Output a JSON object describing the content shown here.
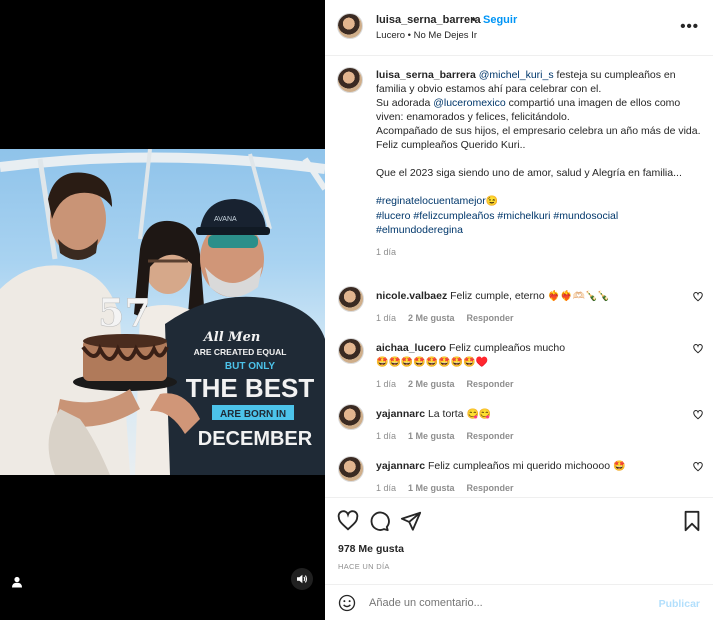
{
  "header": {
    "username": "luisa_serna_barrera",
    "dot": "•",
    "follow_label": "Seguir",
    "subtitle": "Lucero • No Me Dejes Ir",
    "more": "•••"
  },
  "photo": {
    "cake_number": "57",
    "shirt_lines": [
      "All Men",
      "ARE CREATED EQUAL",
      "BUT ONLY",
      "THE BEST",
      "ARE BORN IN",
      "DECEMBER"
    ],
    "cap_text": "AVANA"
  },
  "caption": {
    "username": "luisa_serna_barrera",
    "mention1": "@michel_kuri_s",
    "text1": " festeja su cumpleaños en familia y obvio estamos ahí para celebrar con el.",
    "text2a": "Su adorada ",
    "mention2": "@luceromexico",
    "text2b": " compartió una imagen de ellos como viven: enamorados y felices, felicitándolo.",
    "text3": "Acompañado de sus hijos, el empresario celebra un año más de vida.",
    "text4": "Feliz cumpleaños Querido Kuri..",
    "text5": "Que el 2023 siga siendo uno de amor, salud y Alegría en familia...",
    "hashtag1": "#reginatelocuentamejor",
    "hashtag1_emoji": "😉",
    "hashtags2": "#lucero #felizcumpleaños #michelkuri #mundosocial",
    "hashtags3": "#elmundoderegina",
    "time": "1 día"
  },
  "comments": [
    {
      "username": "nicole.valbaez",
      "text": "Feliz cumple, eterno",
      "emojis": "❤️‍🔥❤️‍🔥🫶🏻🍾🍾",
      "time": "1 día",
      "likes": "2 Me gusta",
      "reply": "Responder"
    },
    {
      "username": "aichaa_lucero",
      "text": "Feliz cumpleaños mucho",
      "emojis": "🤩🤩🤩🤩🤩🤩🤩🤩♥️",
      "time": "1 día",
      "likes": "2 Me gusta",
      "reply": "Responder"
    },
    {
      "username": "yajannarc",
      "text": "La torta",
      "emojis": "😋😋",
      "time": "1 día",
      "likes": "1 Me gusta",
      "reply": "Responder"
    },
    {
      "username": "yajannarc",
      "text": "Feliz cumpleaños mi querido michoooo",
      "emojis": "🤩",
      "time": "1 día",
      "likes": "1 Me gusta",
      "reply": "Responder"
    }
  ],
  "footer": {
    "likes": "978 Me gusta",
    "ago": "HACE UN DÍA",
    "comment_placeholder": "Añade un comentario...",
    "post_label": "Publicar"
  }
}
